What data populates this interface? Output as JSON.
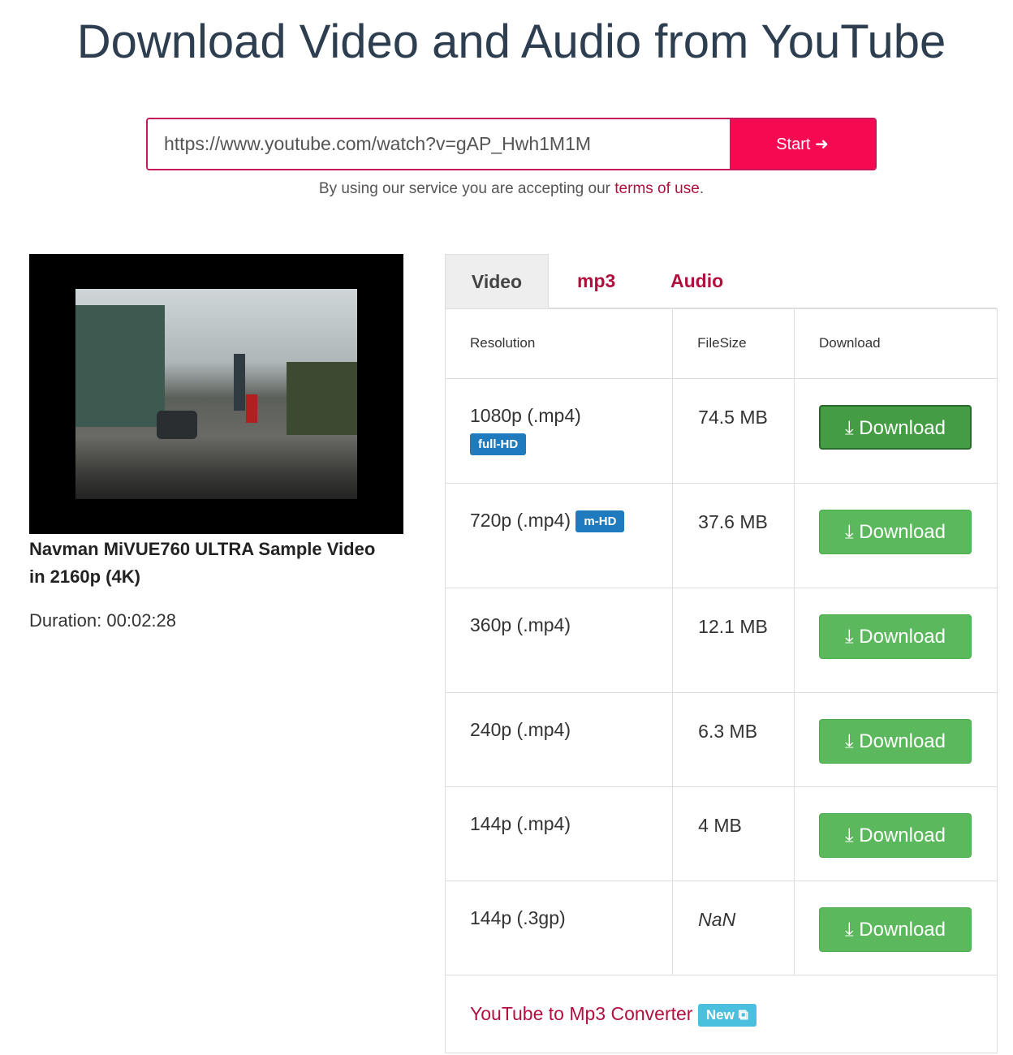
{
  "title": "Download Video and Audio from YouTube",
  "search": {
    "value": "https://www.youtube.com/watch?v=gAP_Hwh1M1M",
    "button": "Start"
  },
  "terms": {
    "prefix": "By using our service you are accepting our ",
    "link": "terms of use",
    "suffix": "."
  },
  "video": {
    "title": "Navman MiVUE760 ULTRA Sample Video in 2160p (4K)",
    "duration": "Duration: 00:02:28"
  },
  "tabs": [
    {
      "label": "Video",
      "active": true
    },
    {
      "label": "mp3"
    },
    {
      "label": "Audio"
    }
  ],
  "table": {
    "headers": [
      "Resolution",
      "FileSize",
      "Download"
    ],
    "rows": [
      {
        "resolution": "1080p (.mp4)",
        "badge": "full-HD",
        "size": "74.5 MB",
        "button": "Download"
      },
      {
        "resolution": "720p (.mp4)",
        "badge": "m-HD",
        "size": "37.6 MB",
        "button": "Download"
      },
      {
        "resolution": "360p (.mp4)",
        "size": "12.1 MB",
        "button": "Download"
      },
      {
        "resolution": "240p (.mp4)",
        "size": "6.3 MB",
        "button": "Download"
      },
      {
        "resolution": "144p (.mp4)",
        "size": "4 MB",
        "button": "Download"
      },
      {
        "resolution": "144p (.3gp)",
        "size": "NaN",
        "button": "Download"
      }
    ]
  },
  "footer": {
    "link": "YouTube to Mp3 Converter",
    "badge": "New"
  }
}
